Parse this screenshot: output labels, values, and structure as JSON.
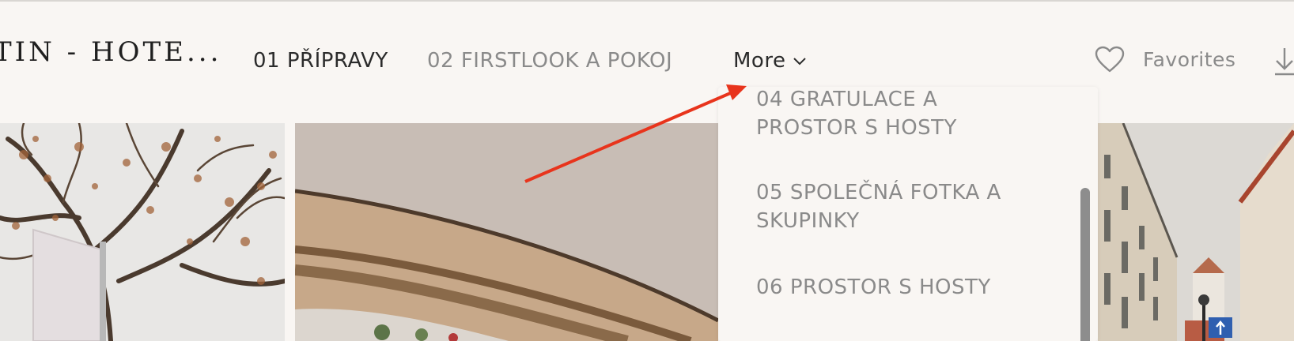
{
  "header": {
    "brand": "TIN - HOTE...",
    "nav": {
      "item1": "01 PŘÍPRAVY",
      "item2": "02 FIRSTLOOK A POKOJ",
      "more": "More"
    },
    "favorites": "Favorites",
    "icons": {
      "favorites": "heart-icon",
      "more": "chevron-down-icon",
      "download": "download-icon"
    }
  },
  "dropdown": {
    "items": [
      {
        "line1": "04 GRATULACE A",
        "line2": "PROSTOR S HOSTY"
      },
      {
        "line1": "05 SPOLEČNÁ FOTKA A",
        "line2": "SKUPINKY"
      },
      {
        "line1": "06 PROSTOR S HOSTY",
        "line2": ""
      }
    ]
  },
  "annotation": {
    "color": "#e8341c"
  }
}
